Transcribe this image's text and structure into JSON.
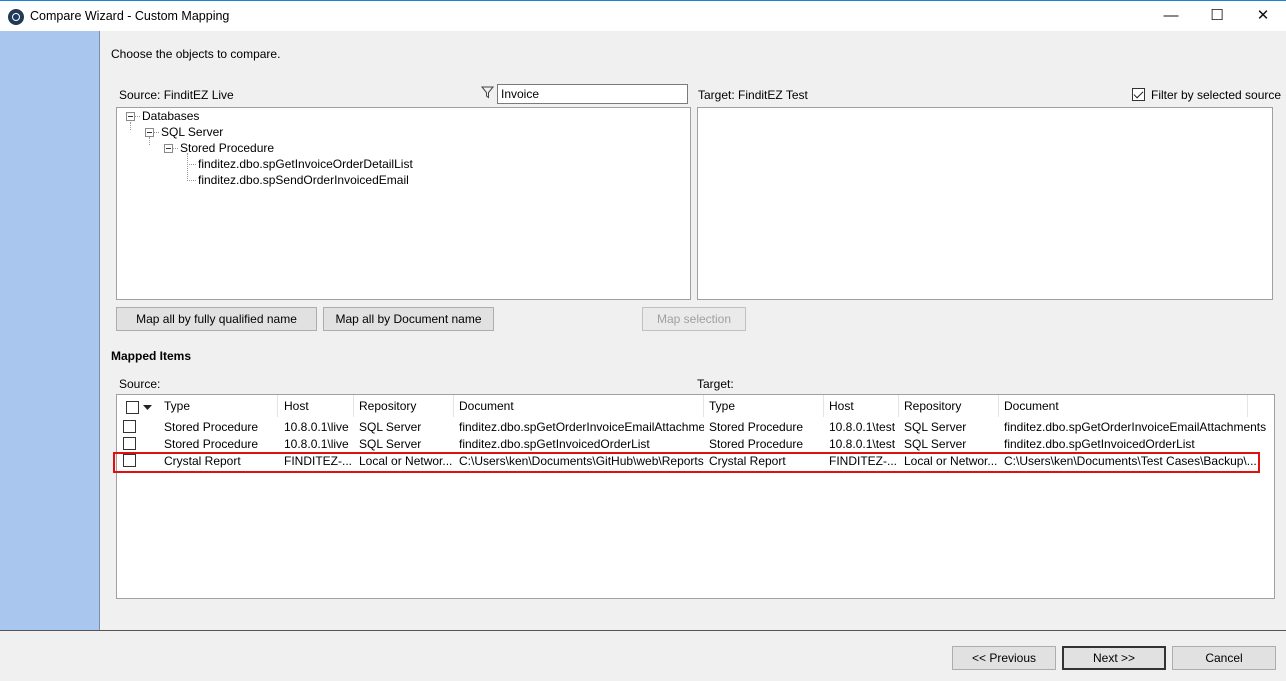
{
  "window": {
    "title": "Compare Wizard - Custom Mapping",
    "minimize": "—",
    "maximize": "☐",
    "close": "✕"
  },
  "instruction": "Choose the objects to compare.",
  "source": {
    "label": "Source: FinditEZ Live",
    "filter_value": "Invoice",
    "tree": {
      "root": "Databases",
      "server": "SQL Server",
      "folder": "Stored Procedure",
      "items": [
        "finditez.dbo.spGetInvoiceOrderDetailList",
        "finditez.dbo.spSendOrderInvoicedEmail"
      ]
    }
  },
  "target": {
    "label": "Target: FinditEZ Test",
    "filter_by_source_label": "Filter by selected source",
    "filter_by_source_checked": true
  },
  "buttons": {
    "map_qualified": "Map all by fully qualified name",
    "map_document": "Map all by Document name",
    "map_selection": "Map selection"
  },
  "mapped": {
    "heading": "Mapped Items",
    "source_label": "Source:",
    "target_label": "Target:",
    "columns": [
      "Type",
      "Host",
      "Repository",
      "Document",
      "Type",
      "Host",
      "Repository",
      "Document"
    ],
    "rows": [
      [
        "Stored Procedure",
        "10.8.0.1\\live",
        "SQL Server",
        "finditez.dbo.spGetOrderInvoiceEmailAttachments",
        "Stored Procedure",
        "10.8.0.1\\test",
        "SQL Server",
        "finditez.dbo.spGetOrderInvoiceEmailAttachments"
      ],
      [
        "Stored Procedure",
        "10.8.0.1\\live",
        "SQL Server",
        "finditez.dbo.spGetInvoicedOrderList",
        "Stored Procedure",
        "10.8.0.1\\test",
        "SQL Server",
        "finditez.dbo.spGetInvoicedOrderList"
      ],
      [
        "Crystal Report",
        "FINDITEZ-...",
        "Local or Networ...",
        "C:\\Users\\ken\\Documents\\GitHub\\web\\Reports...",
        "Crystal Report",
        "FINDITEZ-...",
        "Local or Networ...",
        "C:\\Users\\ken\\Documents\\Test Cases\\Backup\\..."
      ]
    ]
  },
  "nav": {
    "previous": "<< Previous",
    "next": "Next >>",
    "cancel": "Cancel"
  },
  "colors": {
    "accent": "#1883d7",
    "sidebar": "#a9c7ee",
    "highlight": "#e01010"
  }
}
